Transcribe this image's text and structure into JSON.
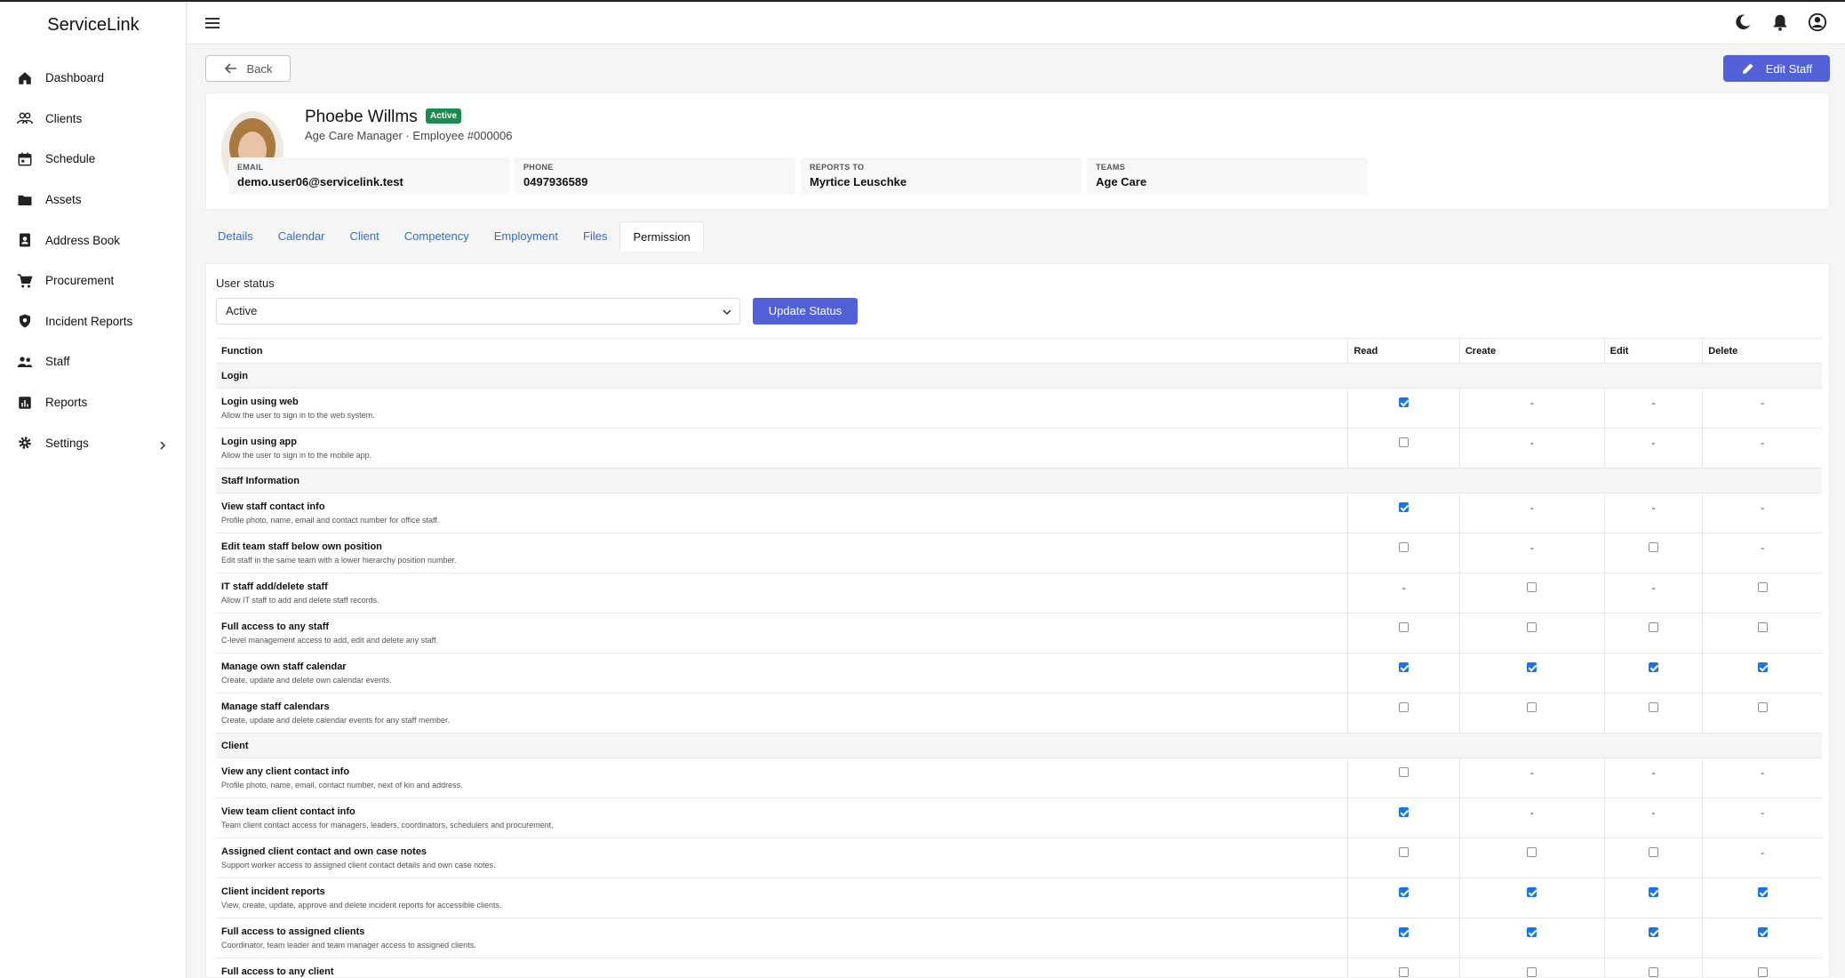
{
  "app": {
    "title": "ServiceLink"
  },
  "sidebar": {
    "items": [
      {
        "label": "Dashboard",
        "icon": "home-icon"
      },
      {
        "label": "Clients",
        "icon": "clients-icon"
      },
      {
        "label": "Schedule",
        "icon": "calendar-icon"
      },
      {
        "label": "Assets",
        "icon": "folder-icon"
      },
      {
        "label": "Address Book",
        "icon": "address-book-icon"
      },
      {
        "label": "Procurement",
        "icon": "cart-icon"
      },
      {
        "label": "Incident Reports",
        "icon": "shield-icon"
      },
      {
        "label": "Staff",
        "icon": "staff-icon"
      },
      {
        "label": "Reports",
        "icon": "bar-chart-icon"
      },
      {
        "label": "Settings",
        "icon": "gear-icon"
      }
    ]
  },
  "toolbar": {
    "back_label": "Back",
    "edit_label": "Edit Staff"
  },
  "profile": {
    "name": "Phoebe Willms",
    "badge": "Active",
    "role": "Age Care Manager · Employee #000006",
    "email_label": "EMAIL",
    "email": "demo.user06@servicelink.test",
    "phone_label": "PHONE",
    "phone": "0497936589",
    "reports_label": "REPORTS TO",
    "reports_to": "Myrtice Leuschke",
    "teams_label": "TEAMS",
    "teams": "Age Care"
  },
  "tabs": [
    "Details",
    "Calendar",
    "Client",
    "Competency",
    "Employment",
    "Files",
    "Permission"
  ],
  "active_tab": "Permission",
  "permission": {
    "user_status_label": "User status",
    "status_value": "Active",
    "update_label": "Update Status",
    "columns": [
      "Function",
      "Read",
      "Create",
      "Edit",
      "Delete"
    ],
    "sections": [
      {
        "title": "Login",
        "rows": [
          {
            "name": "Login using web",
            "desc": "Allow the user to sign in to the web system.",
            "values": [
              "on",
              "-",
              "-",
              "-"
            ]
          },
          {
            "name": "Login using app",
            "desc": "Allow the user to sign in to the mobile app.",
            "values": [
              "off",
              "-",
              "-",
              "-"
            ]
          }
        ]
      },
      {
        "title": "Staff Information",
        "rows": [
          {
            "name": "View staff contact info",
            "desc": "Profile photo, name, email and contact number for office staff.",
            "values": [
              "on",
              "-",
              "-",
              "-"
            ]
          },
          {
            "name": "Edit team staff below own position",
            "desc": "Edit staff in the same team with a lower hierarchy position number.",
            "values": [
              "off",
              "-",
              "off",
              "-"
            ]
          },
          {
            "name": "IT staff add/delete staff",
            "desc": "Allow IT staff to add and delete staff records.",
            "values": [
              "-",
              "off",
              "-",
              "off"
            ]
          },
          {
            "name": "Full access to any staff",
            "desc": "C-level management access to add, edit and delete any staff.",
            "values": [
              "off",
              "off",
              "off",
              "off"
            ]
          },
          {
            "name": "Manage own staff calendar",
            "desc": "Create, update and delete own calendar events.",
            "values": [
              "on",
              "on",
              "on",
              "on"
            ]
          },
          {
            "name": "Manage staff calendars",
            "desc": "Create, update and delete calendar events for any staff member.",
            "values": [
              "off",
              "off",
              "off",
              "off"
            ]
          }
        ]
      },
      {
        "title": "Client",
        "rows": [
          {
            "name": "View any client contact info",
            "desc": "Profile photo, name, email, contact number, next of kin and address.",
            "values": [
              "off",
              "-",
              "-",
              "-"
            ]
          },
          {
            "name": "View team client contact info",
            "desc": "Team client contact access for managers, leaders, coordinators, schedulers and procurement.",
            "values": [
              "on",
              "-",
              "-",
              "-"
            ]
          },
          {
            "name": "Assigned client contact and own case notes",
            "desc": "Support worker access to assigned client contact details and own case notes.",
            "values": [
              "off",
              "off",
              "off",
              "-"
            ]
          },
          {
            "name": "Client incident reports",
            "desc": "View, create, update, approve and delete incident reports for accessible clients.",
            "values": [
              "on",
              "on",
              "on",
              "on"
            ]
          },
          {
            "name": "Full access to assigned clients",
            "desc": "Coordinator, team leader and team manager access to assigned clients.",
            "values": [
              "on",
              "on",
              "on",
              "on"
            ]
          },
          {
            "name": "Full access to any client",
            "desc": "",
            "values": [
              "off",
              "off",
              "off",
              "off"
            ]
          }
        ]
      }
    ]
  },
  "colors": {
    "accent": "#5262d6",
    "active_badge": "#1c8b4e",
    "link": "#2f6bd8",
    "checkbox": "#1a73e8"
  }
}
